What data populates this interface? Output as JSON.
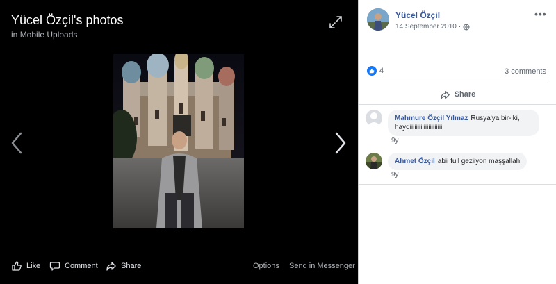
{
  "viewer": {
    "title": "Yücel Özçil's photos",
    "subtitle_prefix": "in",
    "album": "Mobile Uploads",
    "actions": {
      "like": "Like",
      "comment": "Comment",
      "share": "Share",
      "options": "Options",
      "send_messenger": "Send in Messenger"
    }
  },
  "post": {
    "author": "Yücel Özçil",
    "date": "14 September 2010",
    "privacy_separator": "·",
    "reaction_count": "4",
    "comments_link": "3 comments",
    "share_label": "Share"
  },
  "comments": [
    {
      "name": "Mahmure Özçil Yılmaz",
      "text_line1": "Rusya'ya bir-iki,",
      "text_line2": "haydiiiiiiiiiiiiiiiiiiiii",
      "time": "9y"
    },
    {
      "name": "Ahmet Özçil",
      "text_line1": "abii full geziiyon maşşallah",
      "time": "9y"
    }
  ],
  "colors": {
    "link_blue": "#385898",
    "like_blue": "#1877f2",
    "viewer_bg": "#000000"
  }
}
